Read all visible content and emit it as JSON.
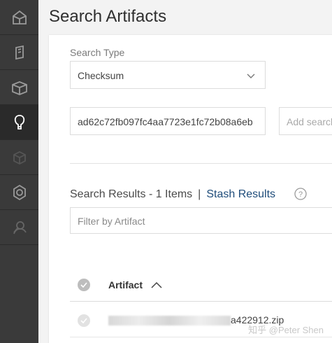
{
  "sidebar": {
    "items": [
      {
        "icon": "home-icon",
        "active": false
      },
      {
        "icon": "artifacts-icon",
        "active": false
      },
      {
        "icon": "package-icon",
        "active": false
      },
      {
        "icon": "search-artifacts-icon",
        "active": true
      },
      {
        "icon": "distribution-icon",
        "active": false
      },
      {
        "icon": "admin-icon",
        "active": false
      },
      {
        "icon": "user-icon",
        "active": false
      }
    ]
  },
  "header": {
    "title": "Search Artifacts"
  },
  "search": {
    "type_label": "Search Type",
    "type_value": "Checksum",
    "checksum_value": "ad62c72fb097fc4aa7723e1fc72b08a6eb",
    "add_placeholder": "Add search"
  },
  "results": {
    "title": "Search Results - 1 Items",
    "separator": "|",
    "stash_label": "Stash Results",
    "filter_placeholder": "Filter by Artifact",
    "columns": {
      "artifact": "Artifact"
    },
    "rows": [
      {
        "artifact_suffix": "a422912.zip"
      }
    ]
  },
  "watermark": "知乎 @Peter Shen",
  "colors": {
    "sidebar_bg": "#3a3a3a",
    "active_icon": "#ffffff",
    "link": "#1e4c7a"
  }
}
